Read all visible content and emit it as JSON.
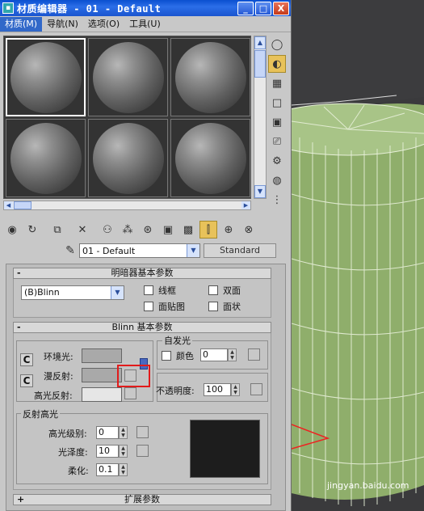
{
  "window": {
    "title": "材质编辑器 - 01 - Default",
    "min_label": "_",
    "max_label": "□",
    "close_label": "X"
  },
  "menu": [
    "材质(M)",
    "导航(N)",
    "选项(O)",
    "工具(U)"
  ],
  "material": {
    "name": "01 - Default",
    "type_button": "Standard"
  },
  "shader_rollout": {
    "title": "明暗器基本参数",
    "sign": "-",
    "shader": "(B)Blinn",
    "options": [
      "线框",
      "双面",
      "面贴图",
      "面状"
    ]
  },
  "blinn_rollout": {
    "title": "Blinn 基本参数",
    "sign": "-",
    "ambient_label": "环境光:",
    "diffuse_label": "漫反射:",
    "specular_label": "高光反射:",
    "self_illum": {
      "group_label": "自发光",
      "color_label": "颜色",
      "value": "0"
    },
    "opacity_label": "不透明度:",
    "opacity_value": "100",
    "spec_highlights": {
      "group_label": "反射高光",
      "level_label": "高光级别:",
      "level_value": "0",
      "gloss_label": "光泽度:",
      "gloss_value": "10",
      "soften_label": "柔化:",
      "soften_value": "0.1"
    }
  },
  "extended_rollout": {
    "title": "扩展参数",
    "sign": "+"
  },
  "c_buttons": [
    "C",
    "C"
  ],
  "watermark": "jingyan.baidu.com",
  "colors": {
    "title_bar": "#1a55cf",
    "ambient_swatch": "#a9a9a9",
    "diffuse_swatch": "#a9a9a9",
    "specular_swatch": "#e6e6e6",
    "highlight_box": "#e21b1b",
    "viewport_object": "#8fae6b"
  }
}
